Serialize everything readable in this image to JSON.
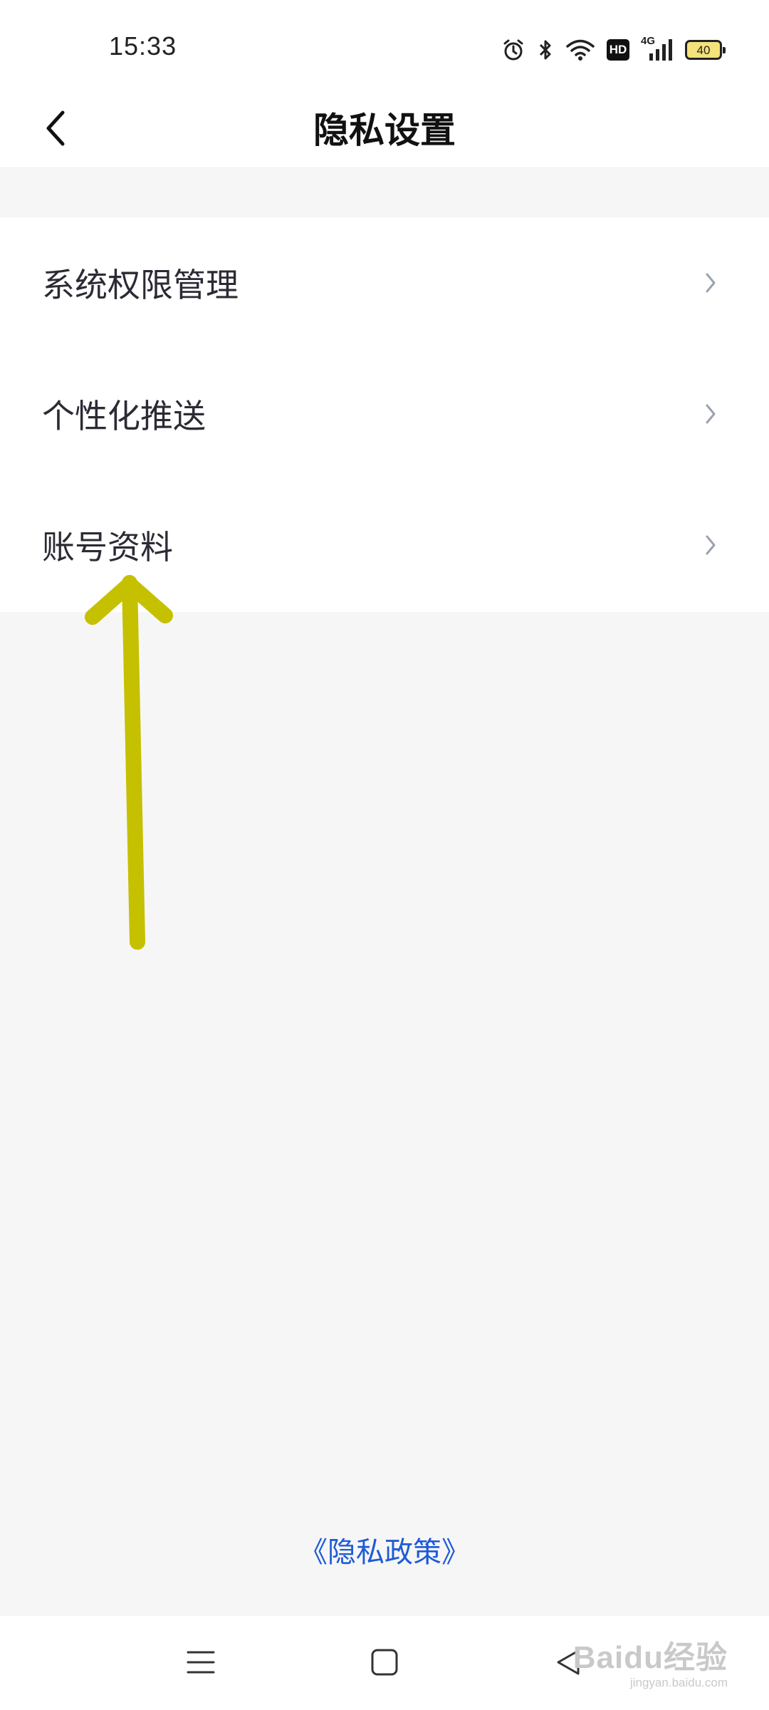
{
  "status_bar": {
    "time": "15:33",
    "icons": [
      "alarm-icon",
      "bluetooth-icon",
      "wifi-icon",
      "hd-icon",
      "signal-4g-icon",
      "battery-icon"
    ],
    "hd_label": "HD",
    "network_label": "4G",
    "battery_level": "40"
  },
  "header": {
    "title": "隐私设置",
    "back_icon": "chevron-left-icon"
  },
  "menu": {
    "items": [
      {
        "label": "系统权限管理"
      },
      {
        "label": "个性化推送"
      },
      {
        "label": "账号资料"
      }
    ]
  },
  "footer": {
    "policy_link": "《隐私政策》"
  },
  "annotation": {
    "color": "#c5c000"
  },
  "colors": {
    "background": "#f6f6f6",
    "card": "#ffffff",
    "link": "#1e5bd6",
    "chevron": "#9aa3b0"
  },
  "watermark": {
    "main": "Baidu经验",
    "sub": "jingyan.baidu.com"
  }
}
